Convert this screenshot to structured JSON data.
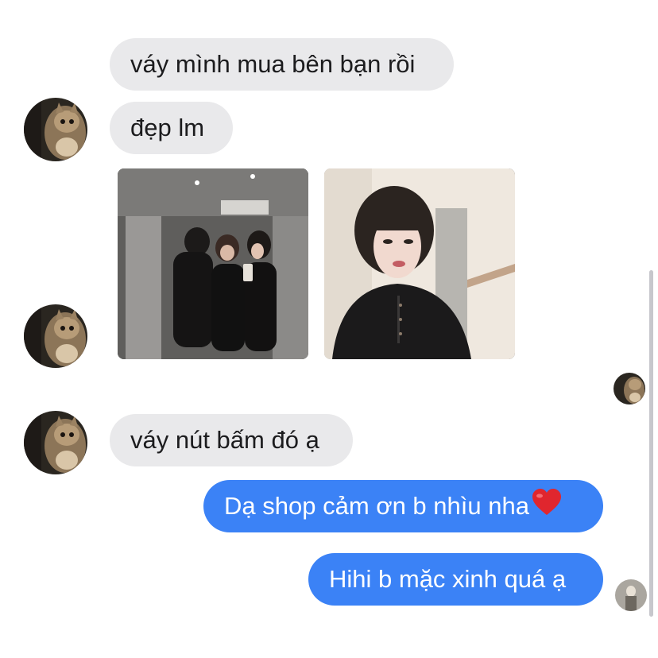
{
  "conversation": {
    "messages": [
      {
        "side": "incoming",
        "text": "váy mình mua bên bạn rồi"
      },
      {
        "side": "incoming",
        "text": "đẹp lm"
      },
      {
        "side": "incoming",
        "text": "váy nút bấm đó ạ"
      },
      {
        "side": "outgoing",
        "text": "Dạ shop cảm ơn b nhìu nha",
        "emoji": "❤️"
      },
      {
        "side": "outgoing",
        "text": "Hihi b mặc xinh quá ạ"
      }
    ],
    "photos": [
      {
        "name": "group-selfie-photo"
      },
      {
        "name": "portrait-photo"
      }
    ]
  },
  "icons": {
    "contact_avatar": "cat-avatar-icon",
    "read_receipt": "read-receipt-avatar-icon",
    "heart": "red-heart-icon"
  },
  "colors": {
    "incoming_bubble": "#e9e9eb",
    "outgoing_bubble": "#3b82f6",
    "heart": "#e0262e"
  }
}
